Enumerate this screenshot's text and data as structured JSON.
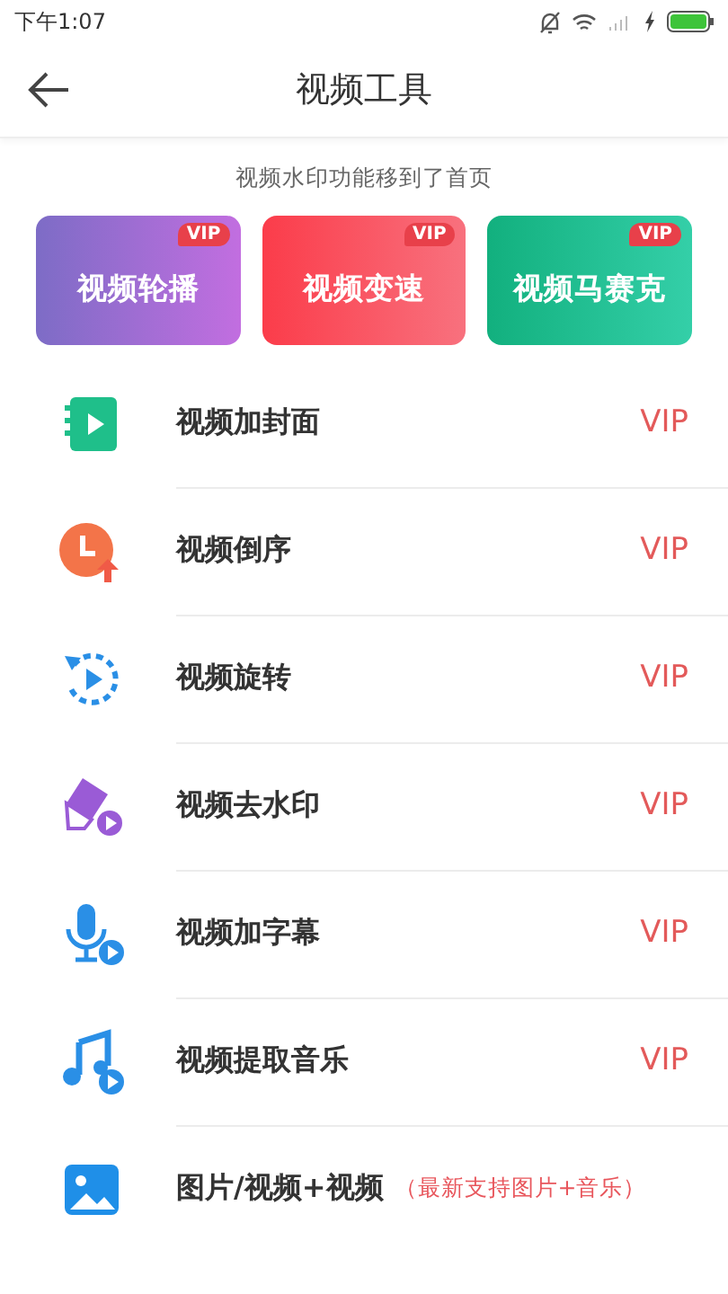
{
  "status_bar": {
    "time": "下午1:07"
  },
  "header": {
    "title": "视频工具"
  },
  "notice": "视频水印功能移到了首页",
  "cards": [
    {
      "label": "视频轮播",
      "badge": "VIP"
    },
    {
      "label": "视频变速",
      "badge": "VIP"
    },
    {
      "label": "视频马赛克",
      "badge": "VIP"
    }
  ],
  "tools": [
    {
      "label": "视频加封面",
      "badge": "VIP"
    },
    {
      "label": "视频倒序",
      "badge": "VIP"
    },
    {
      "label": "视频旋转",
      "badge": "VIP"
    },
    {
      "label": "视频去水印",
      "badge": "VIP"
    },
    {
      "label": "视频加字幕",
      "badge": "VIP"
    },
    {
      "label": "视频提取音乐",
      "badge": "VIP"
    },
    {
      "label": "图片/视频+视频",
      "note": "（最新支持图片+音乐）"
    }
  ]
}
